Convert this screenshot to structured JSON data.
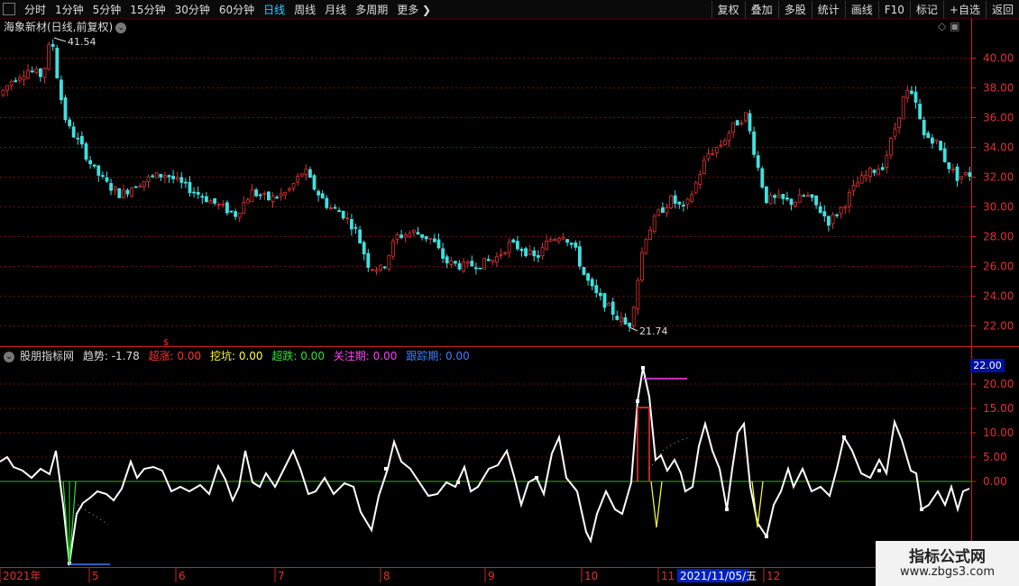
{
  "toolbar": {
    "periods": [
      {
        "label": "分时"
      },
      {
        "label": "1分钟"
      },
      {
        "label": "5分钟"
      },
      {
        "label": "15分钟"
      },
      {
        "label": "30分钟"
      },
      {
        "label": "60分钟"
      },
      {
        "label": "日线",
        "active": true
      },
      {
        "label": "周线"
      },
      {
        "label": "月线"
      },
      {
        "label": "多周期"
      },
      {
        "label": "更多 ❯"
      }
    ],
    "actions": [
      {
        "label": "复权"
      },
      {
        "label": "叠加"
      },
      {
        "label": "多股"
      },
      {
        "label": "统计"
      },
      {
        "label": "画线"
      },
      {
        "label": "F10"
      },
      {
        "label": "标记"
      },
      {
        "label": "+自选"
      },
      {
        "label": "返回"
      }
    ]
  },
  "main_chart": {
    "title": "海象新材(日线,前复权)",
    "high_label": "41.54",
    "low_label": "21.74",
    "y_ticks": [
      "40.00",
      "38.00",
      "36.00",
      "34.00",
      "32.00",
      "30.00",
      "28.00",
      "26.00",
      "24.00",
      "22.00"
    ],
    "marker_symbol": "$"
  },
  "indicator": {
    "name": "股朋指标网",
    "items": [
      {
        "label": "趋势:",
        "value": "-1.78",
        "color": "#dddddd"
      },
      {
        "label": "超涨:",
        "value": "0.00",
        "color": "#ff3030"
      },
      {
        "label": "挖坑:",
        "value": "0.00",
        "color": "#ffff40"
      },
      {
        "label": "超跌:",
        "value": "0.00",
        "color": "#30e030"
      },
      {
        "label": "关注期:",
        "value": "0.00",
        "color": "#ff40ff"
      },
      {
        "label": "跟踪期:",
        "value": "0.00",
        "color": "#4080ff"
      }
    ],
    "y_ticks": [
      "20.00",
      "15.00",
      "10.00",
      "5.00",
      "0.00"
    ],
    "current_tag": "22.00"
  },
  "x_axis": {
    "labels": [
      "2021年",
      "5",
      "6",
      "7",
      "8",
      "9",
      "10",
      "11",
      "12"
    ],
    "cursor_date": "2021/11/05/五"
  },
  "watermark": {
    "title": "指标公式网",
    "url": "www.zbgs3.com"
  },
  "colors": {
    "up": "#e03030",
    "down": "#40e0e0",
    "grid": "#6a1010",
    "axis": "#cc2020"
  }
}
